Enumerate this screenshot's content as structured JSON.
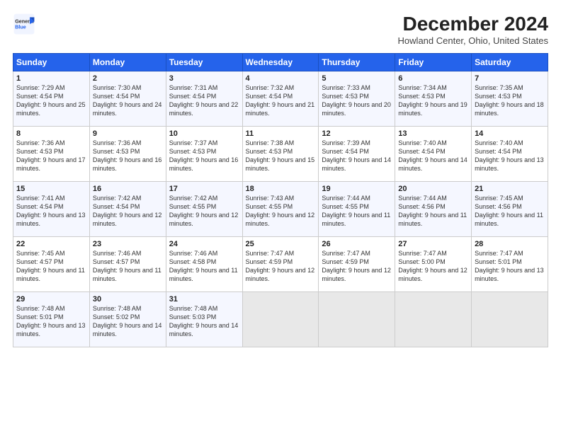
{
  "header": {
    "logo_general": "General",
    "logo_blue": "Blue",
    "title": "December 2024",
    "subtitle": "Howland Center, Ohio, United States"
  },
  "weekdays": [
    "Sunday",
    "Monday",
    "Tuesday",
    "Wednesday",
    "Thursday",
    "Friday",
    "Saturday"
  ],
  "weeks": [
    [
      {
        "day": "1",
        "sunrise": "7:29 AM",
        "sunset": "4:54 PM",
        "daylight": "9 hours and 25 minutes."
      },
      {
        "day": "2",
        "sunrise": "7:30 AM",
        "sunset": "4:54 PM",
        "daylight": "9 hours and 24 minutes."
      },
      {
        "day": "3",
        "sunrise": "7:31 AM",
        "sunset": "4:54 PM",
        "daylight": "9 hours and 22 minutes."
      },
      {
        "day": "4",
        "sunrise": "7:32 AM",
        "sunset": "4:54 PM",
        "daylight": "9 hours and 21 minutes."
      },
      {
        "day": "5",
        "sunrise": "7:33 AM",
        "sunset": "4:53 PM",
        "daylight": "9 hours and 20 minutes."
      },
      {
        "day": "6",
        "sunrise": "7:34 AM",
        "sunset": "4:53 PM",
        "daylight": "9 hours and 19 minutes."
      },
      {
        "day": "7",
        "sunrise": "7:35 AM",
        "sunset": "4:53 PM",
        "daylight": "9 hours and 18 minutes."
      }
    ],
    [
      {
        "day": "8",
        "sunrise": "7:36 AM",
        "sunset": "4:53 PM",
        "daylight": "9 hours and 17 minutes."
      },
      {
        "day": "9",
        "sunrise": "7:36 AM",
        "sunset": "4:53 PM",
        "daylight": "9 hours and 16 minutes."
      },
      {
        "day": "10",
        "sunrise": "7:37 AM",
        "sunset": "4:53 PM",
        "daylight": "9 hours and 16 minutes."
      },
      {
        "day": "11",
        "sunrise": "7:38 AM",
        "sunset": "4:53 PM",
        "daylight": "9 hours and 15 minutes."
      },
      {
        "day": "12",
        "sunrise": "7:39 AM",
        "sunset": "4:54 PM",
        "daylight": "9 hours and 14 minutes."
      },
      {
        "day": "13",
        "sunrise": "7:40 AM",
        "sunset": "4:54 PM",
        "daylight": "9 hours and 14 minutes."
      },
      {
        "day": "14",
        "sunrise": "7:40 AM",
        "sunset": "4:54 PM",
        "daylight": "9 hours and 13 minutes."
      }
    ],
    [
      {
        "day": "15",
        "sunrise": "7:41 AM",
        "sunset": "4:54 PM",
        "daylight": "9 hours and 13 minutes."
      },
      {
        "day": "16",
        "sunrise": "7:42 AM",
        "sunset": "4:54 PM",
        "daylight": "9 hours and 12 minutes."
      },
      {
        "day": "17",
        "sunrise": "7:42 AM",
        "sunset": "4:55 PM",
        "daylight": "9 hours and 12 minutes."
      },
      {
        "day": "18",
        "sunrise": "7:43 AM",
        "sunset": "4:55 PM",
        "daylight": "9 hours and 12 minutes."
      },
      {
        "day": "19",
        "sunrise": "7:44 AM",
        "sunset": "4:55 PM",
        "daylight": "9 hours and 11 minutes."
      },
      {
        "day": "20",
        "sunrise": "7:44 AM",
        "sunset": "4:56 PM",
        "daylight": "9 hours and 11 minutes."
      },
      {
        "day": "21",
        "sunrise": "7:45 AM",
        "sunset": "4:56 PM",
        "daylight": "9 hours and 11 minutes."
      }
    ],
    [
      {
        "day": "22",
        "sunrise": "7:45 AM",
        "sunset": "4:57 PM",
        "daylight": "9 hours and 11 minutes."
      },
      {
        "day": "23",
        "sunrise": "7:46 AM",
        "sunset": "4:57 PM",
        "daylight": "9 hours and 11 minutes."
      },
      {
        "day": "24",
        "sunrise": "7:46 AM",
        "sunset": "4:58 PM",
        "daylight": "9 hours and 11 minutes."
      },
      {
        "day": "25",
        "sunrise": "7:47 AM",
        "sunset": "4:59 PM",
        "daylight": "9 hours and 12 minutes."
      },
      {
        "day": "26",
        "sunrise": "7:47 AM",
        "sunset": "4:59 PM",
        "daylight": "9 hours and 12 minutes."
      },
      {
        "day": "27",
        "sunrise": "7:47 AM",
        "sunset": "5:00 PM",
        "daylight": "9 hours and 12 minutes."
      },
      {
        "day": "28",
        "sunrise": "7:47 AM",
        "sunset": "5:01 PM",
        "daylight": "9 hours and 13 minutes."
      }
    ],
    [
      {
        "day": "29",
        "sunrise": "7:48 AM",
        "sunset": "5:01 PM",
        "daylight": "9 hours and 13 minutes."
      },
      {
        "day": "30",
        "sunrise": "7:48 AM",
        "sunset": "5:02 PM",
        "daylight": "9 hours and 14 minutes."
      },
      {
        "day": "31",
        "sunrise": "7:48 AM",
        "sunset": "5:03 PM",
        "daylight": "9 hours and 14 minutes."
      },
      null,
      null,
      null,
      null
    ]
  ],
  "labels": {
    "sunrise": "Sunrise:",
    "sunset": "Sunset:",
    "daylight": "Daylight:"
  }
}
